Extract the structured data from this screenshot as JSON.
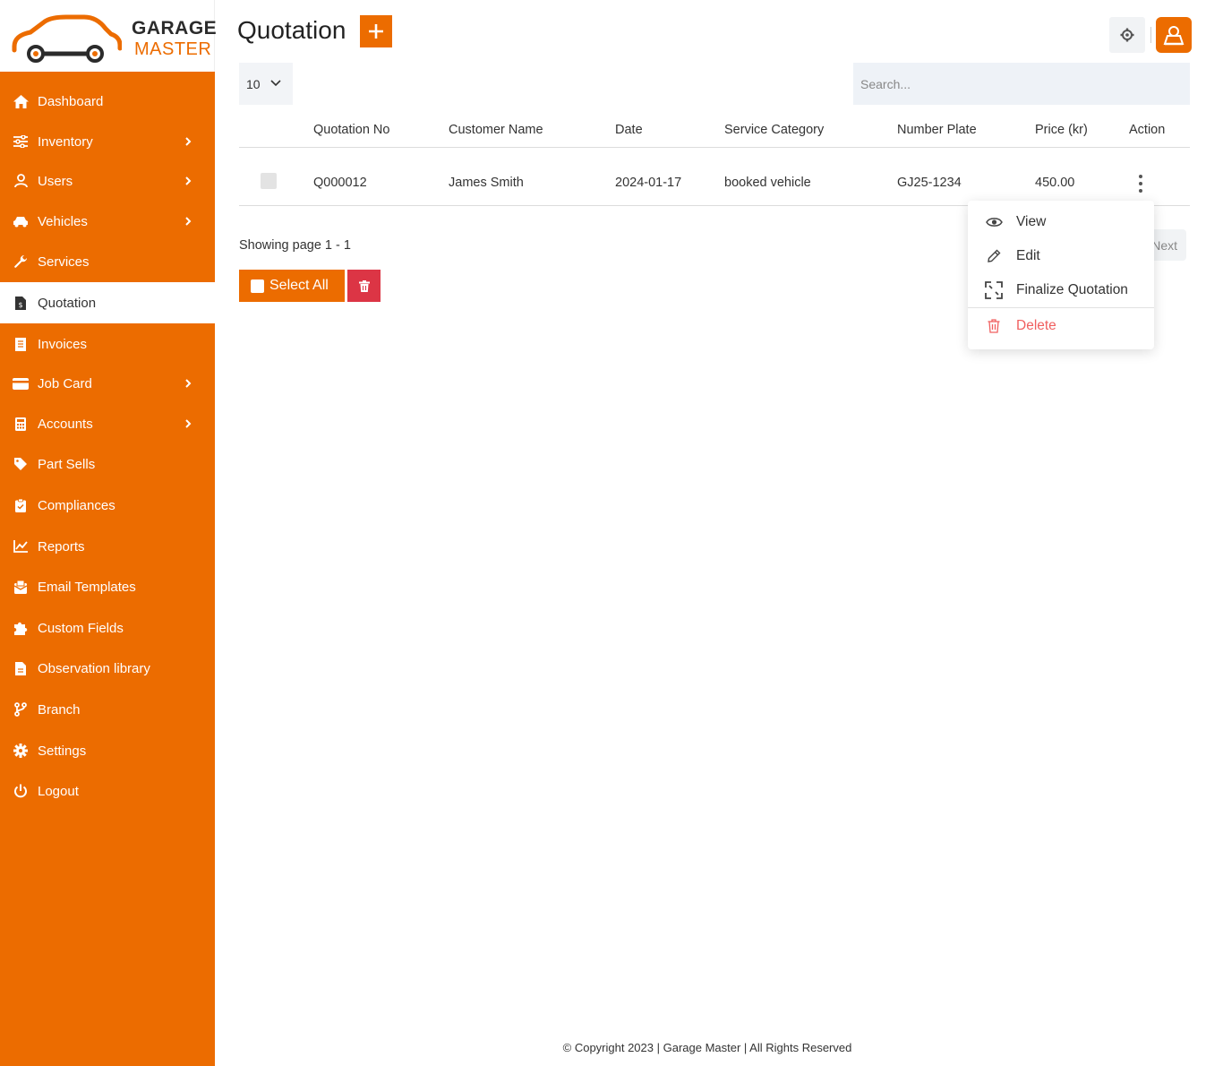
{
  "brand": {
    "line1": "GARAGE",
    "line2": "MASTER",
    "accent_color": "#ec6c00",
    "danger_color": "#dc3545"
  },
  "sidebar": {
    "items": [
      {
        "label": "Dashboard",
        "icon": "home-icon",
        "has_submenu": false,
        "active": false
      },
      {
        "label": "Inventory",
        "icon": "sliders-icon",
        "has_submenu": true,
        "active": false
      },
      {
        "label": "Users",
        "icon": "user-icon",
        "has_submenu": true,
        "active": false
      },
      {
        "label": "Vehicles",
        "icon": "car-icon",
        "has_submenu": true,
        "active": false
      },
      {
        "label": "Services",
        "icon": "wrench-icon",
        "has_submenu": false,
        "active": false
      },
      {
        "label": "Quotation",
        "icon": "file-dollar-icon",
        "has_submenu": false,
        "active": true
      },
      {
        "label": "Invoices",
        "icon": "receipt-icon",
        "has_submenu": false,
        "active": false
      },
      {
        "label": "Job Card",
        "icon": "credit-card-icon",
        "has_submenu": true,
        "active": false
      },
      {
        "label": "Accounts",
        "icon": "calculator-icon",
        "has_submenu": true,
        "active": false
      },
      {
        "label": "Part Sells",
        "icon": "tag-icon",
        "has_submenu": false,
        "active": false
      },
      {
        "label": "Compliances",
        "icon": "clipboard-check-icon",
        "has_submenu": false,
        "active": false
      },
      {
        "label": "Reports",
        "icon": "line-chart-icon",
        "has_submenu": false,
        "active": false
      },
      {
        "label": "Email Templates",
        "icon": "envelope-icon",
        "has_submenu": false,
        "active": false
      },
      {
        "label": "Custom Fields",
        "icon": "puzzle-icon",
        "has_submenu": false,
        "active": false
      },
      {
        "label": "Observation library",
        "icon": "document-icon",
        "has_submenu": false,
        "active": false
      },
      {
        "label": "Branch",
        "icon": "branch-icon",
        "has_submenu": false,
        "active": false
      },
      {
        "label": "Settings",
        "icon": "gear-icon",
        "has_submenu": false,
        "active": false
      },
      {
        "label": "Logout",
        "icon": "power-icon",
        "has_submenu": false,
        "active": false
      }
    ]
  },
  "header": {
    "title": "Quotation",
    "add_label": "+"
  },
  "controls": {
    "page_size": "10",
    "search_placeholder": "Search..."
  },
  "table": {
    "columns": [
      "Quotation No",
      "Customer Name",
      "Date",
      "Service Category",
      "Number Plate",
      "Price (kr)",
      "Action"
    ],
    "rows": [
      {
        "quotation_no": "Q000012",
        "customer": "James Smith",
        "date": "2024-01-17",
        "category": "booked vehicle",
        "plate": "GJ25-1234",
        "price": "450.00"
      }
    ]
  },
  "pagination": {
    "showing": "Showing page 1 - 1",
    "next": "Next"
  },
  "bulk": {
    "select_all": "Select All"
  },
  "dropdown": {
    "items": [
      {
        "label": "View",
        "icon": "eye-icon"
      },
      {
        "label": "Edit",
        "icon": "pencil-icon"
      },
      {
        "label": "Finalize Quotation",
        "icon": "expand-icon"
      },
      {
        "label": "Delete",
        "icon": "trash-icon"
      }
    ]
  },
  "footer": {
    "text": "© Copyright 2023 | Garage Master | All Rights Reserved"
  }
}
